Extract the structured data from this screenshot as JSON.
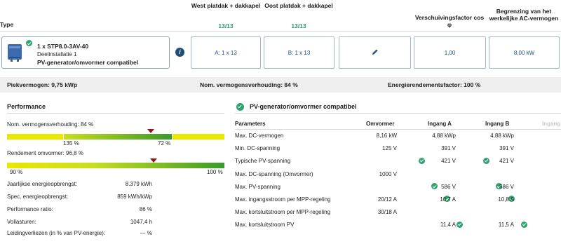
{
  "colors": {
    "accent": "#2a9a6a",
    "link": "#1f4d7a",
    "bar_yellow": "#e8e800",
    "bar_green": "#3a9a2a",
    "marker": "#8a1a1a"
  },
  "header": {
    "type_label": "Type",
    "col_west": "West platdak + dakkapel",
    "col_west_count": "13/13",
    "col_oost": "Oost platdak + dakkapel",
    "col_oost_count": "13/13",
    "col_phase": "Verschuivingsfactor cos φ",
    "col_limit": "Begrenzing van het werkelijke AC-vermogen"
  },
  "inverter": {
    "name": "1 x STP8.0-3AV-40",
    "sub": "Deelinstallatie 1",
    "status": "PV-generator/omvormer compatibel",
    "icon": "inverter-icon",
    "info_icon": "info-icon",
    "input_a": "A: 1 x 13",
    "input_b": "B: 1 x 13",
    "edit_icon": "pencil-icon",
    "cos_phi": "1,00",
    "ac_limit": "8,00 kW"
  },
  "summary": {
    "peak": "Piekvermogen: 9,75 kWp",
    "ratio": "Nom. vermogensverhouding: 84 %",
    "efficiency": "Energierendementsfactor: 100 %"
  },
  "performance": {
    "title": "Performance",
    "ratio_label": "Nom. vermogensverhouding: 84 %",
    "ratio_min": "135 %",
    "ratio_max": "72 %",
    "ratio_marker": 0.84,
    "eff_label": "Rendement omvormer: 96,8 %",
    "eff_min": "90 %",
    "eff_max": "100 %",
    "eff_marker": 0.968,
    "rows": [
      {
        "label": "Jaarlijkse energieopbrengst:",
        "value": "8.379 kWh"
      },
      {
        "label": "Spec. energieopbrengst:",
        "value": "859 kWh/kWp"
      },
      {
        "label": "Performance ratio:",
        "value": "86 %"
      },
      {
        "label": "Vollasturen:",
        "value": "1047,4 h"
      },
      {
        "label": "Leidingverliezen (in % van PV-energie):",
        "value": "--- %"
      }
    ]
  },
  "compat": {
    "title": "PV-generator/omvormer compatibel",
    "col_params": "Parameters",
    "col_inv": "Omvormer",
    "col_a": "Ingang A",
    "col_b": "Ingang B",
    "col_c": "Ingang",
    "rows": [
      {
        "label": "Max. DC-vermogen",
        "inv": "8,16 kW",
        "a": "4,88 kWp",
        "a_check": false,
        "b": "4,88 kWp",
        "b_check": false
      },
      {
        "label": "Min. DC-spanning",
        "inv": "125 V",
        "a": "391 V",
        "a_check": false,
        "b": "391 V",
        "b_check": false
      },
      {
        "label": "Typische PV-spanning",
        "inv": "",
        "a": "421 V",
        "a_check": true,
        "b": "421 V",
        "b_check": true
      },
      {
        "label": "Max. DC-spanning (Omvormer)",
        "inv": "1000 V",
        "a": "",
        "a_check": false,
        "b": "",
        "b_check": false
      },
      {
        "label": "Max. PV-spanning",
        "inv": "",
        "a": "586 V",
        "a_check": true,
        "b": "586 V",
        "b_check": true
      },
      {
        "label": "Max. ingangsstroom per MPP-regeling",
        "inv": "20/12 A",
        "a": "10,7 A",
        "a_check": true,
        "b": "10,8 A",
        "b_check": true
      },
      {
        "label": "Max. kortsluitstroom per MPP-regeling",
        "inv": "30/18 A",
        "a": "",
        "a_check": false,
        "b": "",
        "b_check": false
      },
      {
        "label": "Max. kortsluitstroom PV",
        "inv": "",
        "a": "11,4 A",
        "a_check": true,
        "b": "11,5 A",
        "b_check": true
      }
    ]
  }
}
